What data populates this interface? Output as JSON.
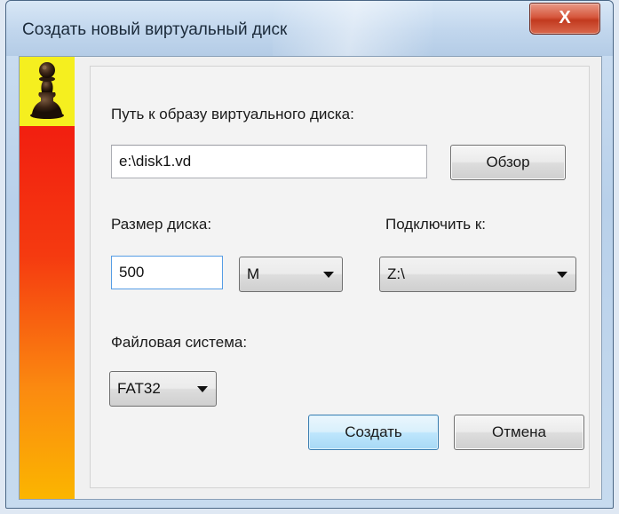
{
  "window": {
    "title": "Создать новый виртуальный диск",
    "close_glyph": "X"
  },
  "sidebar": {
    "icon": "chess-pawn-icon",
    "colors": {
      "top": "#f5ef1f",
      "gradient_start": "#f01010",
      "gradient_end": "#fbb500"
    }
  },
  "form": {
    "path_label": "Путь к образу виртуального диска:",
    "path_value": "e:\\disk1.vd",
    "browse_label": "Обзор",
    "size_label": "Размер диска:",
    "size_value": "500",
    "unit_value": "M",
    "mount_label": "Подключить к:",
    "mount_value": "Z:\\",
    "fs_label": "Файловая система:",
    "fs_value": "FAT32"
  },
  "buttons": {
    "create_label": "Создать",
    "cancel_label": "Отмена"
  }
}
